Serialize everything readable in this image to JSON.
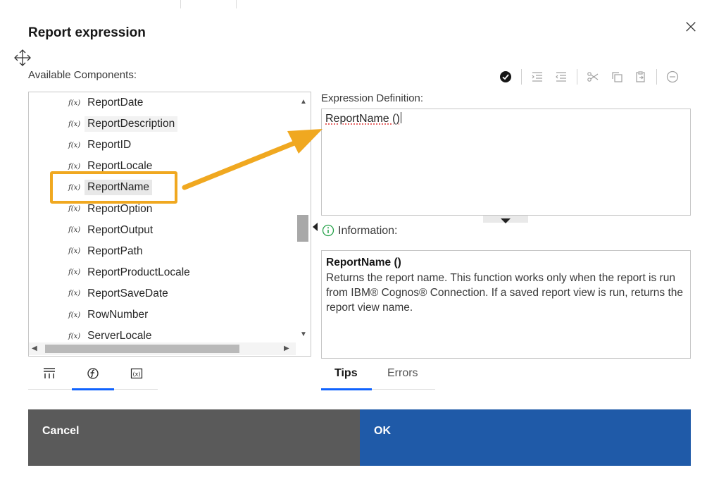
{
  "dialog": {
    "title": "Report expression",
    "close_glyph": "×"
  },
  "available_components": {
    "label": "Available Components:",
    "items": [
      {
        "label": "ReportDate"
      },
      {
        "label": "ReportDescription"
      },
      {
        "label": "ReportID"
      },
      {
        "label": "ReportLocale"
      },
      {
        "label": "ReportName",
        "selected": true
      },
      {
        "label": "ReportOption"
      },
      {
        "label": "ReportOutput"
      },
      {
        "label": "ReportPath"
      },
      {
        "label": "ReportProductLocale"
      },
      {
        "label": "ReportSaveDate"
      },
      {
        "label": "RowNumber"
      },
      {
        "label": "ServerLocale"
      }
    ],
    "item_icon": "function-icon",
    "item_icon_glyph": "f(x)"
  },
  "toolbar": {
    "icons": [
      "validate-icon",
      "indent-icon",
      "outdent-icon",
      "cut-icon",
      "copy-icon",
      "paste-icon",
      "remove-icon"
    ]
  },
  "expression": {
    "label": "Expression Definition:",
    "value": "ReportName ()"
  },
  "information": {
    "label": "Information:",
    "title": "ReportName ()",
    "body": "Returns the report name. This function works only when the report is run from IBM® Cognos® Connection. If a saved report view is run, returns the report view name."
  },
  "left_tabs": [
    "data-items-icon",
    "functions-icon",
    "parameters-icon"
  ],
  "right_tabs": {
    "tips": "Tips",
    "errors": "Errors"
  },
  "buttons": {
    "cancel": "Cancel",
    "ok": "OK"
  },
  "colors": {
    "primary": "#1f5aa8",
    "secondary": "#5a5a5a",
    "annotation": "#f0a820",
    "tab_active": "#0f62fe"
  }
}
